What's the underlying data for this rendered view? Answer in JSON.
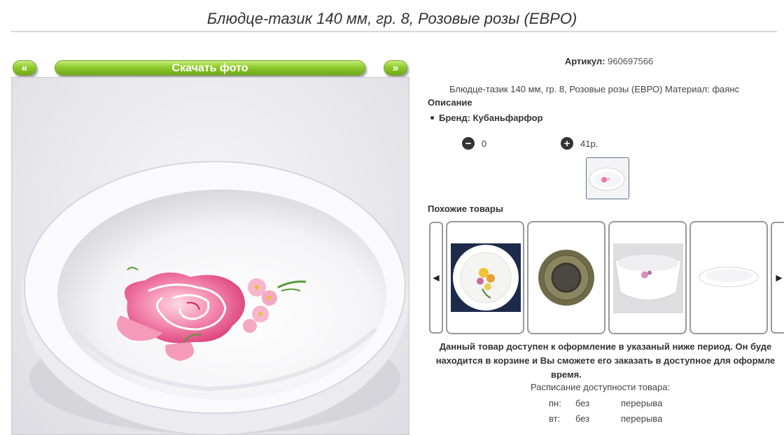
{
  "page": {
    "title": "Блюдце-тазик 140 мм, гр. 8, Розовые розы (ЕВРО)"
  },
  "gallery": {
    "prev_label": "«",
    "download_label": "Скачать фото",
    "next_label": "»"
  },
  "product": {
    "article_label": "Артикул:",
    "article_value": "960697566",
    "description_line": "Блюдце-тазик 140 мм, гр. 8, Розовые розы (ЕВРО) Материал: фаянс",
    "description_heading": "Описание",
    "brand_line": "Бренд: Кубаньфарфор",
    "quantity": "0",
    "price": "41р."
  },
  "similar": {
    "heading": "Похожие товары"
  },
  "availability": {
    "line1": "Данный товар доступен к оформление в указаный ниже период. Он буде",
    "line2": "находится в корзине и Вы сможете его заказать в доступное для оформле",
    "line3": "время.",
    "schedule_heading": "Расписание доступности товара:",
    "rows": [
      {
        "day": "пн:",
        "from": "без",
        "to": "перерыва"
      },
      {
        "day": "вт:",
        "from": "без",
        "to": "перерыва"
      }
    ]
  },
  "colors": {
    "button_green": "#8fcb2c",
    "rose_pink": "#e8588a"
  }
}
